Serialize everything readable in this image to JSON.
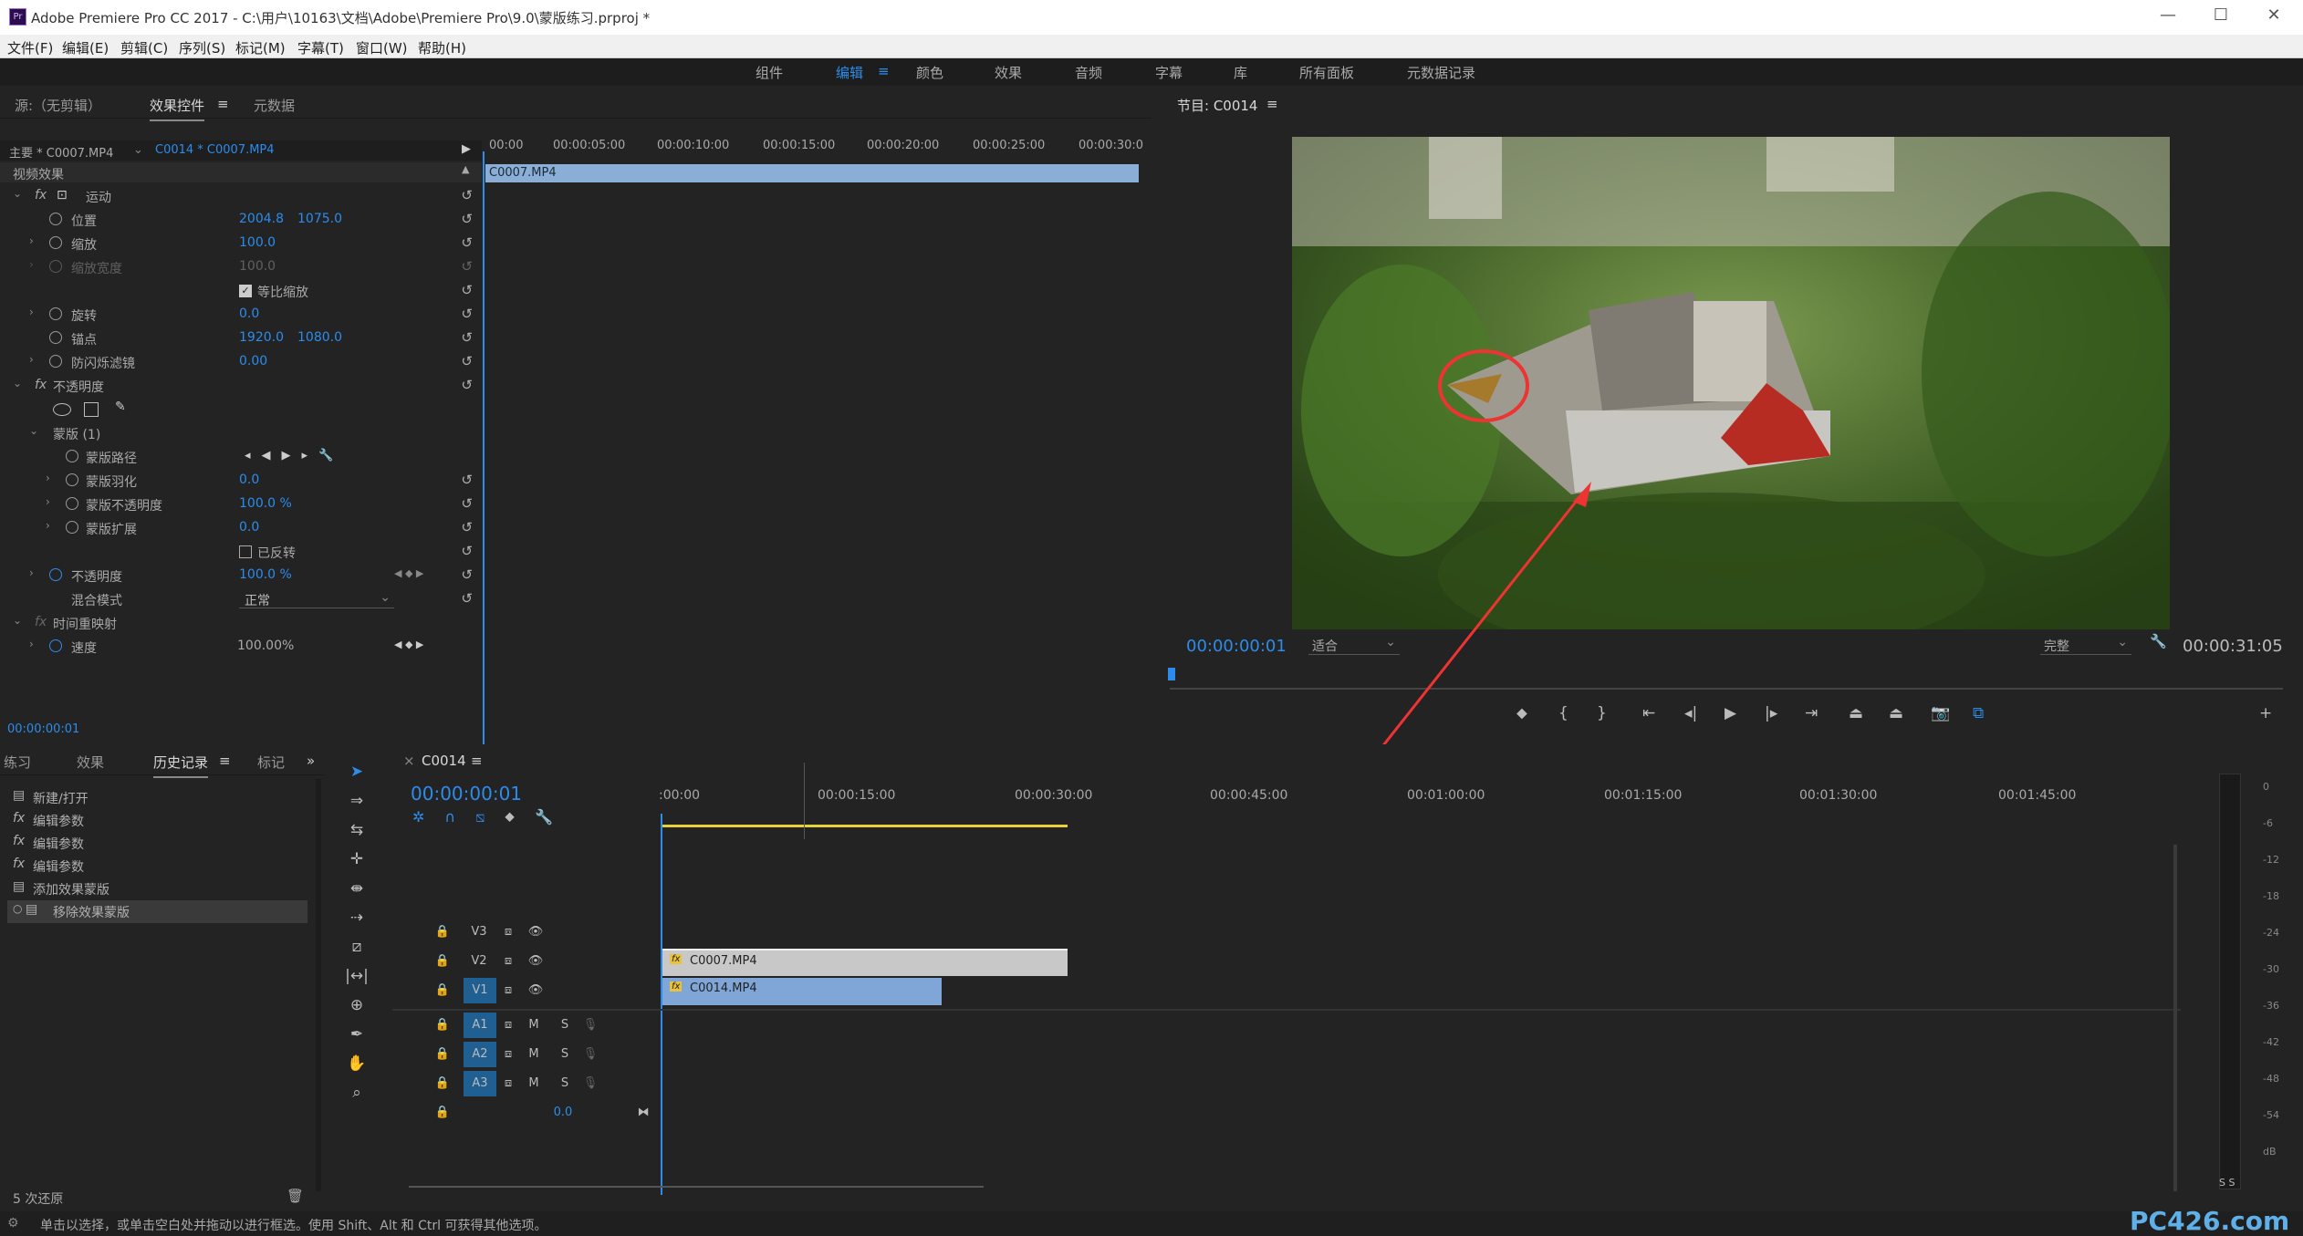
{
  "app": {
    "title": "Adobe Premiere Pro CC 2017 - C:\\用户\\10163\\文档\\Adobe\\Premiere Pro\\9.0\\蒙版练习.prproj *",
    "logo": "Pr"
  },
  "menu": [
    "文件(F)",
    "编辑(E)",
    "剪辑(C)",
    "序列(S)",
    "标记(M)",
    "字幕(T)",
    "窗口(W)",
    "帮助(H)"
  ],
  "workspaces": [
    "组件",
    "编辑",
    "颜色",
    "效果",
    "音频",
    "字幕",
    "库",
    "所有面板",
    "元数据记录"
  ],
  "source_panel": {
    "tabs": [
      "源:（无剪辑）",
      "效果控件",
      "元数据"
    ],
    "master": "主要 * C0007.MP4",
    "sequence_clip": "C0014 * C0007.MP4",
    "section": "视频效果",
    "ruler": [
      "00:00",
      "00:00:05:00",
      "00:00:10:00",
      "00:00:15:00",
      "00:00:20:00",
      "00:00:25:00",
      "00:00:30:0"
    ],
    "clip_label": "C0007.MP4",
    "timecode": "00:00:00:01"
  },
  "effects": {
    "motion": "运动",
    "position": "位置",
    "position_x": "2004.8",
    "position_y": "1075.0",
    "scale": "缩放",
    "scale_val": "100.0",
    "scale_width": "缩放宽度",
    "scale_width_val": "100.0",
    "uniform_scale": "等比缩放",
    "rotation": "旋转",
    "rotation_val": "0.0",
    "anchor": "锚点",
    "anchor_x": "1920.0",
    "anchor_y": "1080.0",
    "anti_flicker": "防闪烁滤镜",
    "anti_flicker_val": "0.00",
    "opacity_group": "不透明度",
    "mask": "蒙版 (1)",
    "mask_path": "蒙版路径",
    "mask_feather": "蒙版羽化",
    "mask_feather_val": "0.0",
    "mask_opacity": "蒙版不透明度",
    "mask_opacity_val": "100.0 %",
    "mask_expand": "蒙版扩展",
    "mask_expand_val": "0.0",
    "inverted": "已反转",
    "opacity": "不透明度",
    "opacity_val": "100.0 %",
    "blend": "混合模式",
    "blend_val": "正常",
    "time_remap": "时间重映射",
    "speed": "速度",
    "speed_val": "100.00%"
  },
  "program": {
    "title": "节目: C0014",
    "timecode": "00:00:00:01",
    "fit": "适合",
    "quality": "完整",
    "duration": "00:00:31:05"
  },
  "history": {
    "tabs": [
      "练习",
      "效果",
      "历史记录",
      "标记"
    ],
    "items": [
      "新建/打开",
      "编辑参数",
      "编辑参数",
      "编辑参数",
      "添加效果蒙版",
      "移除效果蒙版"
    ],
    "footer": "5 次还原"
  },
  "timeline": {
    "name": "C0014",
    "timecode": "00:00:00:01",
    "ruler": [
      ":00:00",
      "00:00:15:00",
      "00:00:30:00",
      "00:00:45:00",
      "00:01:00:00",
      "00:01:15:00",
      "00:01:30:00",
      "00:01:45:00"
    ],
    "video_tracks": [
      "V3",
      "V2",
      "V1"
    ],
    "audio_tracks": [
      "A1",
      "A2",
      "A3"
    ],
    "clips": {
      "v2": "C0007.MP4",
      "v1": "C0014.MP4"
    },
    "master_val": "0.0",
    "mute": "M",
    "solo": "S"
  },
  "meter": {
    "labels": [
      "0",
      "-6",
      "-12",
      "-18",
      "-24",
      "-30",
      "-36",
      "-42",
      "-48",
      "-54",
      "dB"
    ],
    "ss": "S S"
  },
  "status": "单击以选择，或单击空白处并拖动以进行框选。使用 Shift、Alt 和 Ctrl 可获得其他选项。",
  "watermark": "PC426.com"
}
